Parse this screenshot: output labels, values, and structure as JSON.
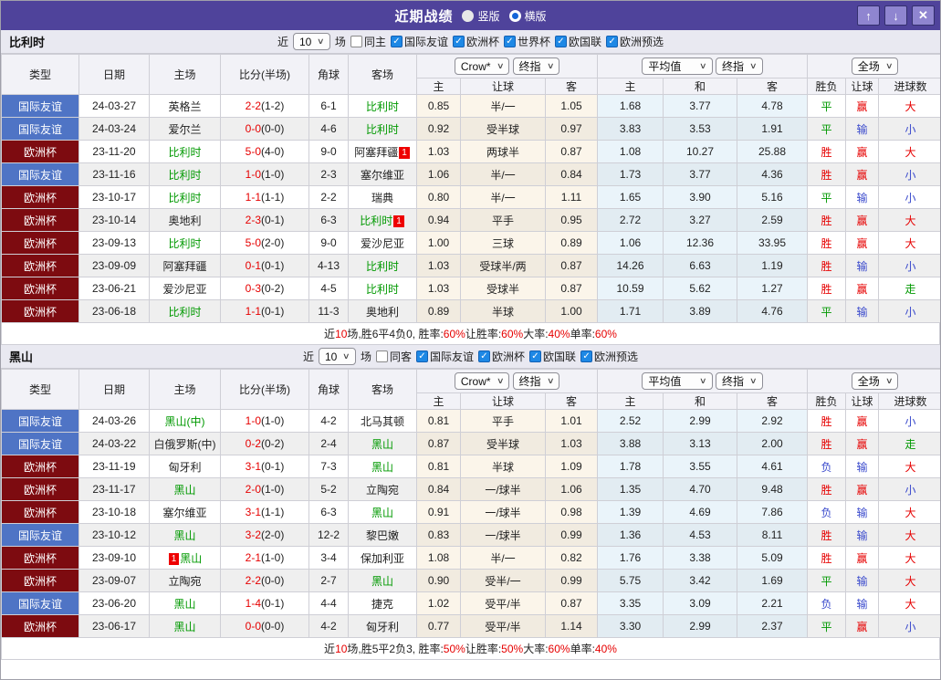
{
  "titlebar": {
    "title": "近期战绩",
    "radios": [
      {
        "label": "竖版",
        "selected": false
      },
      {
        "label": "横版",
        "selected": true
      }
    ],
    "buttons": {
      "up": "↑",
      "down": "↓",
      "close": "✕"
    }
  },
  "table_header": {
    "static_cols": [
      "类型",
      "日期",
      "主场",
      "比分(半场)",
      "角球",
      "客场"
    ],
    "group1": {
      "bookmaker": "Crow*",
      "time": "终指",
      "cols": [
        "主",
        "让球",
        "客"
      ]
    },
    "group2": {
      "name": "平均值",
      "time": "终指",
      "cols": [
        "主",
        "和",
        "客"
      ]
    },
    "group3": {
      "name": "全场",
      "cols": [
        "胜负",
        "让球",
        "进球数"
      ]
    }
  },
  "type_styles": {
    "国际友谊": "#4f74c5",
    "欧洲杯": "#7d0b10"
  },
  "outcome_colors": {
    "胜": "red",
    "平": "green",
    "负": "blue",
    "赢": "red",
    "输": "blue",
    "走": "green",
    "大": "red",
    "小": "blue"
  },
  "colors": {
    "titlebar_bg": "#4f439b",
    "checkbox_blue": "#1e88e5",
    "team_green": "#009900",
    "score_red": "#e60000"
  },
  "sections": [
    {
      "team": "比利时",
      "filter": {
        "near": "近",
        "count": "10",
        "games": "场",
        "same": {
          "label": "同主",
          "checked": false
        },
        "competitions": [
          {
            "label": "国际友谊",
            "checked": true
          },
          {
            "label": "欧洲杯",
            "checked": true
          },
          {
            "label": "世界杯",
            "checked": true
          },
          {
            "label": "欧国联",
            "checked": true
          },
          {
            "label": "欧洲预选",
            "checked": true
          }
        ]
      },
      "rows": [
        {
          "type": "国际友谊",
          "date": "24-03-27",
          "home": {
            "text": "英格兰",
            "green": false
          },
          "score": "2-2",
          "half": "(1-2)",
          "corners": "6-1",
          "away": {
            "text": "比利时",
            "green": true
          },
          "odds": [
            "0.85",
            "半/一",
            "1.05"
          ],
          "avg": [
            "1.68",
            "3.77",
            "4.78"
          ],
          "outcome": [
            "平",
            "赢",
            "大"
          ]
        },
        {
          "type": "国际友谊",
          "date": "24-03-24",
          "home": {
            "text": "爱尔兰",
            "green": false
          },
          "score": "0-0",
          "half": "(0-0)",
          "corners": "4-6",
          "away": {
            "text": "比利时",
            "green": true
          },
          "odds": [
            "0.92",
            "受半球",
            "0.97"
          ],
          "avg": [
            "3.83",
            "3.53",
            "1.91"
          ],
          "outcome": [
            "平",
            "输",
            "小"
          ]
        },
        {
          "type": "欧洲杯",
          "date": "23-11-20",
          "home": {
            "text": "比利时",
            "green": true
          },
          "score": "5-0",
          "half": "(4-0)",
          "corners": "9-0",
          "away": {
            "text": "阿塞拜疆",
            "green": false,
            "badge": "1",
            "badge_pos": "after"
          },
          "odds": [
            "1.03",
            "两球半",
            "0.87"
          ],
          "avg": [
            "1.08",
            "10.27",
            "25.88"
          ],
          "outcome": [
            "胜",
            "赢",
            "大"
          ]
        },
        {
          "type": "国际友谊",
          "date": "23-11-16",
          "home": {
            "text": "比利时",
            "green": true
          },
          "score": "1-0",
          "half": "(1-0)",
          "corners": "2-3",
          "away": {
            "text": "塞尔维亚",
            "green": false
          },
          "odds": [
            "1.06",
            "半/一",
            "0.84"
          ],
          "avg": [
            "1.73",
            "3.77",
            "4.36"
          ],
          "outcome": [
            "胜",
            "赢",
            "小"
          ]
        },
        {
          "type": "欧洲杯",
          "date": "23-10-17",
          "home": {
            "text": "比利时",
            "green": true
          },
          "score": "1-1",
          "half": "(1-1)",
          "corners": "2-2",
          "away": {
            "text": "瑞典",
            "green": false
          },
          "odds": [
            "0.80",
            "半/一",
            "1.11"
          ],
          "avg": [
            "1.65",
            "3.90",
            "5.16"
          ],
          "outcome": [
            "平",
            "输",
            "小"
          ]
        },
        {
          "type": "欧洲杯",
          "date": "23-10-14",
          "home": {
            "text": "奥地利",
            "green": false
          },
          "score": "2-3",
          "half": "(0-1)",
          "corners": "6-3",
          "away": {
            "text": "比利时",
            "green": true,
            "badge": "1",
            "badge_pos": "after"
          },
          "odds": [
            "0.94",
            "平手",
            "0.95"
          ],
          "avg": [
            "2.72",
            "3.27",
            "2.59"
          ],
          "outcome": [
            "胜",
            "赢",
            "大"
          ]
        },
        {
          "type": "欧洲杯",
          "date": "23-09-13",
          "home": {
            "text": "比利时",
            "green": true
          },
          "score": "5-0",
          "half": "(2-0)",
          "corners": "9-0",
          "away": {
            "text": "爱沙尼亚",
            "green": false
          },
          "odds": [
            "1.00",
            "三球",
            "0.89"
          ],
          "avg": [
            "1.06",
            "12.36",
            "33.95"
          ],
          "outcome": [
            "胜",
            "赢",
            "大"
          ]
        },
        {
          "type": "欧洲杯",
          "date": "23-09-09",
          "home": {
            "text": "阿塞拜疆",
            "green": false
          },
          "score": "0-1",
          "half": "(0-1)",
          "corners": "4-13",
          "away": {
            "text": "比利时",
            "green": true
          },
          "odds": [
            "1.03",
            "受球半/两",
            "0.87"
          ],
          "avg": [
            "14.26",
            "6.63",
            "1.19"
          ],
          "outcome": [
            "胜",
            "输",
            "小"
          ]
        },
        {
          "type": "欧洲杯",
          "date": "23-06-21",
          "home": {
            "text": "爱沙尼亚",
            "green": false
          },
          "score": "0-3",
          "half": "(0-2)",
          "corners": "4-5",
          "away": {
            "text": "比利时",
            "green": true
          },
          "odds": [
            "1.03",
            "受球半",
            "0.87"
          ],
          "avg": [
            "10.59",
            "5.62",
            "1.27"
          ],
          "outcome": [
            "胜",
            "赢",
            "走"
          ]
        },
        {
          "type": "欧洲杯",
          "date": "23-06-18",
          "home": {
            "text": "比利时",
            "green": true
          },
          "score": "1-1",
          "half": "(0-1)",
          "corners": "11-3",
          "away": {
            "text": "奥地利",
            "green": false
          },
          "odds": [
            "0.89",
            "半球",
            "1.00"
          ],
          "avg": [
            "1.71",
            "3.89",
            "4.76"
          ],
          "outcome": [
            "平",
            "输",
            "小"
          ]
        }
      ],
      "summary_parts": [
        "近",
        "10",
        "场,胜6平4负0, 胜率:",
        "60%",
        " 让胜率:",
        "60%",
        " 大率:",
        "40%",
        " 单率:",
        "60%"
      ]
    },
    {
      "team": "黑山",
      "filter": {
        "near": "近",
        "count": "10",
        "games": "场",
        "same": {
          "label": "同客",
          "checked": false
        },
        "competitions": [
          {
            "label": "国际友谊",
            "checked": true
          },
          {
            "label": "欧洲杯",
            "checked": true
          },
          {
            "label": "欧国联",
            "checked": true
          },
          {
            "label": "欧洲预选",
            "checked": true
          }
        ]
      },
      "rows": [
        {
          "type": "国际友谊",
          "date": "24-03-26",
          "home": {
            "text": "黑山(中)",
            "green": true
          },
          "score": "1-0",
          "half": "(1-0)",
          "corners": "4-2",
          "away": {
            "text": "北马其顿",
            "green": false
          },
          "odds": [
            "0.81",
            "平手",
            "1.01"
          ],
          "avg": [
            "2.52",
            "2.99",
            "2.92"
          ],
          "outcome": [
            "胜",
            "赢",
            "小"
          ]
        },
        {
          "type": "国际友谊",
          "date": "24-03-22",
          "home": {
            "text": "白俄罗斯(中)",
            "green": false
          },
          "score": "0-2",
          "half": "(0-2)",
          "corners": "2-4",
          "away": {
            "text": "黑山",
            "green": true
          },
          "odds": [
            "0.87",
            "受半球",
            "1.03"
          ],
          "avg": [
            "3.88",
            "3.13",
            "2.00"
          ],
          "outcome": [
            "胜",
            "赢",
            "走"
          ]
        },
        {
          "type": "欧洲杯",
          "date": "23-11-19",
          "home": {
            "text": "匈牙利",
            "green": false
          },
          "score": "3-1",
          "half": "(0-1)",
          "corners": "7-3",
          "away": {
            "text": "黑山",
            "green": true
          },
          "odds": [
            "0.81",
            "半球",
            "1.09"
          ],
          "avg": [
            "1.78",
            "3.55",
            "4.61"
          ],
          "outcome": [
            "负",
            "输",
            "大"
          ]
        },
        {
          "type": "欧洲杯",
          "date": "23-11-17",
          "home": {
            "text": "黑山",
            "green": true
          },
          "score": "2-0",
          "half": "(1-0)",
          "corners": "5-2",
          "away": {
            "text": "立陶宛",
            "green": false
          },
          "odds": [
            "0.84",
            "一/球半",
            "1.06"
          ],
          "avg": [
            "1.35",
            "4.70",
            "9.48"
          ],
          "outcome": [
            "胜",
            "赢",
            "小"
          ]
        },
        {
          "type": "欧洲杯",
          "date": "23-10-18",
          "home": {
            "text": "塞尔维亚",
            "green": false
          },
          "score": "3-1",
          "half": "(1-1)",
          "corners": "6-3",
          "away": {
            "text": "黑山",
            "green": true
          },
          "odds": [
            "0.91",
            "一/球半",
            "0.98"
          ],
          "avg": [
            "1.39",
            "4.69",
            "7.86"
          ],
          "outcome": [
            "负",
            "输",
            "大"
          ]
        },
        {
          "type": "国际友谊",
          "date": "23-10-12",
          "home": {
            "text": "黑山",
            "green": true
          },
          "score": "3-2",
          "half": "(2-0)",
          "corners": "12-2",
          "away": {
            "text": "黎巴嫩",
            "green": false
          },
          "odds": [
            "0.83",
            "一/球半",
            "0.99"
          ],
          "avg": [
            "1.36",
            "4.53",
            "8.11"
          ],
          "outcome": [
            "胜",
            "输",
            "大"
          ]
        },
        {
          "type": "欧洲杯",
          "date": "23-09-10",
          "home": {
            "text": "黑山",
            "green": true,
            "badge": "1",
            "badge_pos": "before"
          },
          "score": "2-1",
          "half": "(1-0)",
          "corners": "3-4",
          "away": {
            "text": "保加利亚",
            "green": false
          },
          "odds": [
            "1.08",
            "半/一",
            "0.82"
          ],
          "avg": [
            "1.76",
            "3.38",
            "5.09"
          ],
          "outcome": [
            "胜",
            "赢",
            "大"
          ]
        },
        {
          "type": "欧洲杯",
          "date": "23-09-07",
          "home": {
            "text": "立陶宛",
            "green": false
          },
          "score": "2-2",
          "half": "(0-0)",
          "corners": "2-7",
          "away": {
            "text": "黑山",
            "green": true
          },
          "odds": [
            "0.90",
            "受半/一",
            "0.99"
          ],
          "avg": [
            "5.75",
            "3.42",
            "1.69"
          ],
          "outcome": [
            "平",
            "输",
            "大"
          ]
        },
        {
          "type": "国际友谊",
          "date": "23-06-20",
          "home": {
            "text": "黑山",
            "green": true
          },
          "score": "1-4",
          "half": "(0-1)",
          "corners": "4-4",
          "away": {
            "text": "捷克",
            "green": false
          },
          "odds": [
            "1.02",
            "受平/半",
            "0.87"
          ],
          "avg": [
            "3.35",
            "3.09",
            "2.21"
          ],
          "outcome": [
            "负",
            "输",
            "大"
          ]
        },
        {
          "type": "欧洲杯",
          "date": "23-06-17",
          "home": {
            "text": "黑山",
            "green": true
          },
          "score": "0-0",
          "half": "(0-0)",
          "corners": "4-2",
          "away": {
            "text": "匈牙利",
            "green": false
          },
          "odds": [
            "0.77",
            "受平/半",
            "1.14"
          ],
          "avg": [
            "3.30",
            "2.99",
            "2.37"
          ],
          "outcome": [
            "平",
            "赢",
            "小"
          ]
        }
      ],
      "summary_parts": [
        "近",
        "10",
        "场,胜5平2负3, 胜率:",
        "50%",
        " 让胜率:",
        "50%",
        " 大率:",
        "60%",
        " 单率:",
        "40%"
      ]
    }
  ]
}
